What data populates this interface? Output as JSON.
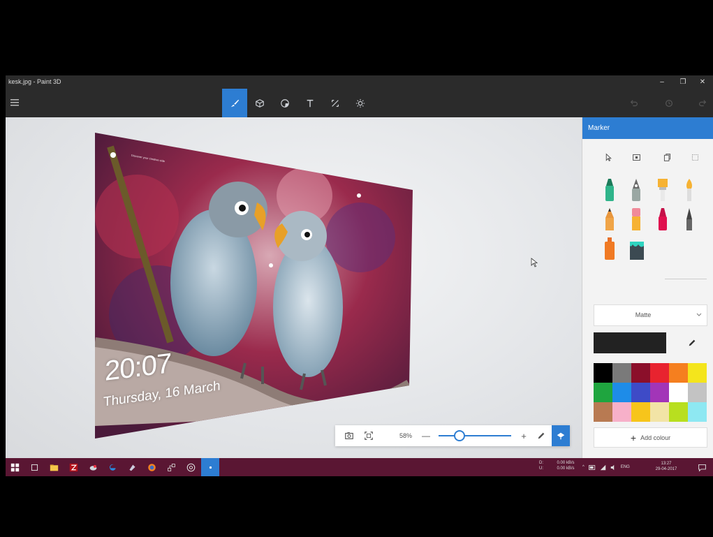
{
  "window": {
    "title": "kesk.jpg - Paint 3D"
  },
  "toolbar": {
    "tools": [
      {
        "name": "brushes",
        "active": true
      },
      {
        "name": "3d-objects",
        "active": false
      },
      {
        "name": "stickers",
        "active": false
      },
      {
        "name": "text",
        "active": false
      },
      {
        "name": "canvas",
        "active": false
      },
      {
        "name": "effects",
        "active": false
      }
    ]
  },
  "canvas": {
    "time": "20:07",
    "date": "Thursday, 16 March",
    "overlay_text": "Discover your creative side"
  },
  "zoombar": {
    "zoom": "58%",
    "minus": "—",
    "plus": "+",
    "zoom_fraction": 0.28
  },
  "panel": {
    "title": "Marker",
    "finish": "Matte",
    "current_color": "#222222",
    "add_colour": "Add colour",
    "palette": [
      "#000000",
      "#7a7a7a",
      "#8b0f2a",
      "#e8232f",
      "#f57f1f",
      "#f4e51c",
      "#1fa53f",
      "#1e8ce8",
      "#3e4bc7",
      "#a235b8",
      "#ffffff",
      "#c3c3c3",
      "#b87a52",
      "#f7b0c9",
      "#f7c51b",
      "#f2e4a6",
      "#b8df1f",
      "#8ee8f2"
    ]
  },
  "taskbar": {
    "net_top": "0.00 kB/s",
    "net_bottom": "0.00 kB/s",
    "net_label_top": "D:",
    "net_label_bottom": "U:",
    "lang": "ENG",
    "time": "13:27",
    "date": "29-04-2017"
  },
  "colors": {
    "accent": "#2d7dd2",
    "taskbar": "#5a1633",
    "titlebar": "#2b2b2b"
  }
}
